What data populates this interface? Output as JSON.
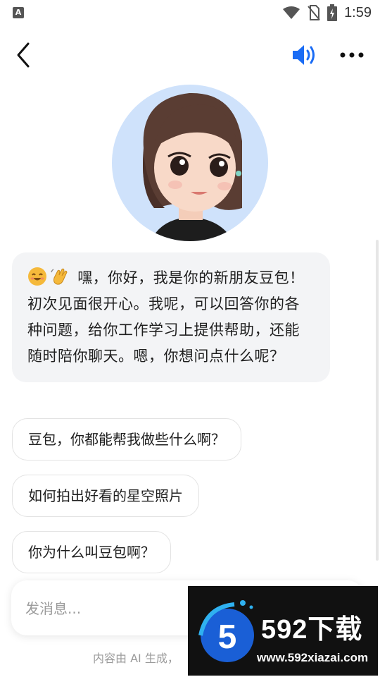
{
  "status_bar": {
    "app_badge": "A",
    "time": "1:59"
  },
  "top_bar": {
    "icons": [
      "chevron-left-icon",
      "speaker-icon",
      "more-icon"
    ],
    "accent": "#1a6cf5"
  },
  "chat": {
    "greeting": {
      "emojis": [
        "smiling-face-emoji",
        "waving-hand-emoji"
      ],
      "text": "嘿，你好，我是你的新朋友豆包！初次见面很开心。我呢，可以回答你的各种问题，给你工作学习上提供帮助，还能随时陪你聊天。嗯，你想问点什么呢？"
    },
    "suggestions": [
      "豆包，你都能帮我做些什么啊？",
      "如何拍出好看的星空照片",
      "你为什么叫豆包啊？"
    ]
  },
  "composer": {
    "placeholder": "发消息..."
  },
  "disclaimer": "内容由 AI 生成，",
  "watermark": {
    "logo_mark": "5",
    "text": "592下载",
    "url": "www.592xiazai.com"
  }
}
